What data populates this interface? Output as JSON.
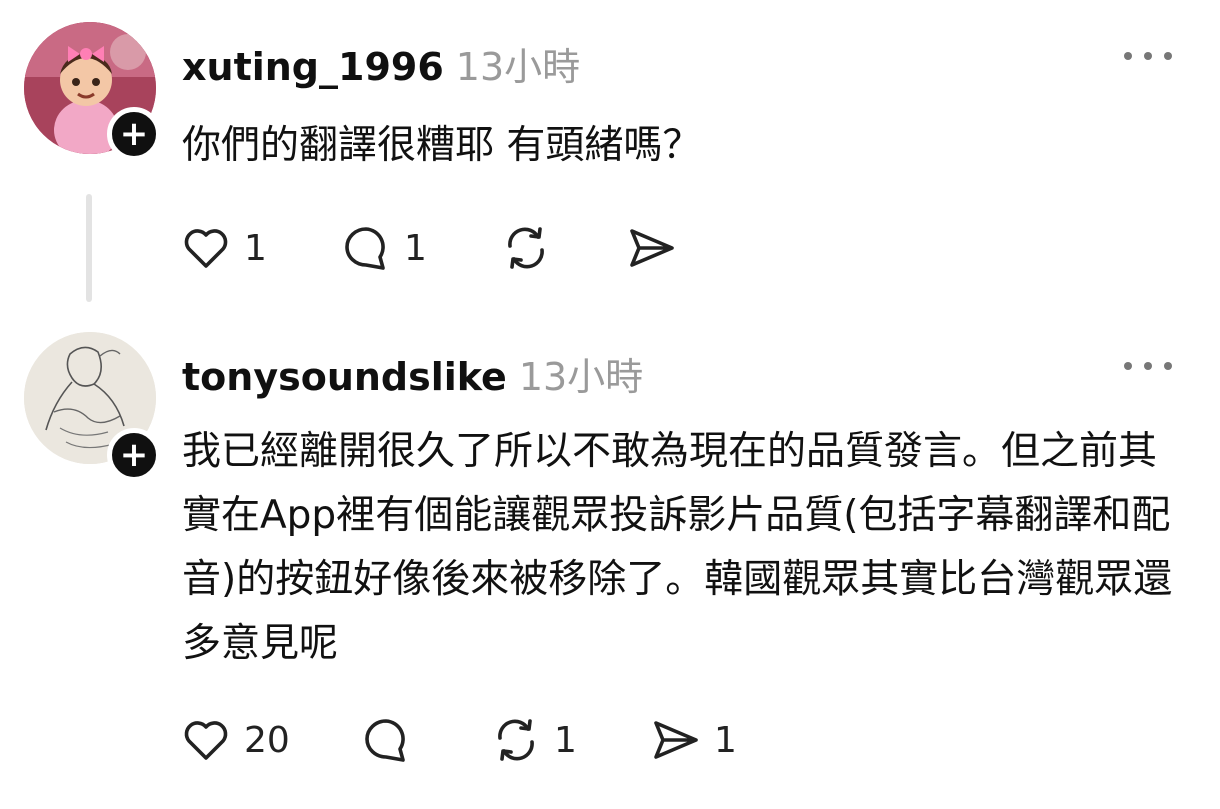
{
  "posts": [
    {
      "username": "xuting_1996",
      "time": "13小時",
      "text": "你們的翻譯很糟耶 有頭緒嗎？",
      "likes": "1",
      "replies": "1",
      "reposts": "",
      "shares": ""
    },
    {
      "username": "tonysoundslike",
      "time": "13小時",
      "text": "我已經離開很久了所以不敢為現在的品質發言。但之前其實在App裡有個能讓觀眾投訴影片品質(包括字幕翻譯和配音)的按鈕好像後來被移除了。韓國觀眾其實比台灣觀眾還多意見呢",
      "likes": "20",
      "replies": "",
      "reposts": "1",
      "shares": "1"
    }
  ],
  "icons": {
    "like": "heart-icon",
    "reply": "comment-bubble-icon",
    "repost": "repost-icon",
    "share": "send-icon",
    "more": "more-dots-icon",
    "follow": "plus-icon"
  }
}
